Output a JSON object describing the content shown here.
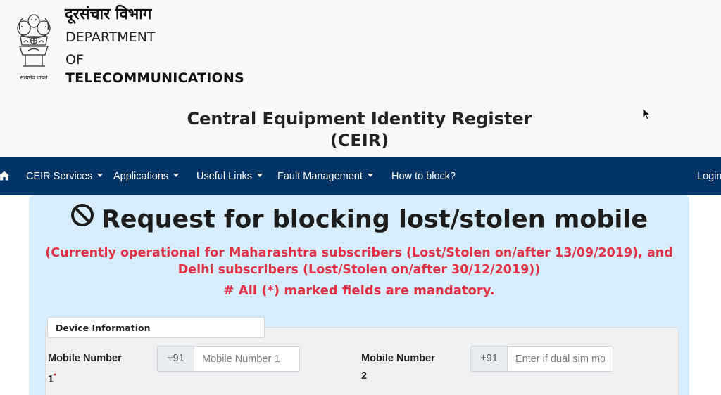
{
  "header": {
    "emblem_caption": "सत्यमेव जयते",
    "org_hindi": "दूरसंचार विभाग",
    "org_line1": "DEPARTMENT",
    "org_line2": "OF",
    "org_line3": "TELECOMMUNICATIONS",
    "site_title_line1": "Central Equipment Identity Register",
    "site_title_line2": "(CEIR)"
  },
  "nav": {
    "home_icon": "home-icon",
    "items": [
      {
        "label": "CEIR Services",
        "dropdown": true
      },
      {
        "label": "Applications",
        "dropdown": true
      },
      {
        "label": "Useful Links",
        "dropdown": true
      },
      {
        "label": "Fault Management",
        "dropdown": true
      },
      {
        "label": "How to block?",
        "dropdown": false
      }
    ],
    "login": "Login"
  },
  "request": {
    "icon": "ban-icon",
    "title": "Request for blocking lost/stolen mobile",
    "notice_line1": "(Currently operational for Maharashtra subscribers (Lost/Stolen on/after 13/09/2019), and",
    "notice_line2": "Delhi subscribers (Lost/Stolen on/after 30/12/2019))",
    "mandatory": "# All (*) marked fields are mandatory."
  },
  "device_info": {
    "tab_label": "Device Information",
    "field1": {
      "label_line1": "Mobile Number",
      "label_line2": "1",
      "required_mark": "*",
      "prefix": "+91",
      "value": "",
      "placeholder": "Mobile Number 1"
    },
    "field2": {
      "label_line1": "Mobile Number",
      "label_line2": "2",
      "prefix": "+91",
      "value": "",
      "placeholder": "Enter if dual sim mobile"
    }
  },
  "colors": {
    "navbar": "#003366",
    "panel": "#d7ecfc",
    "notice": "#e03345",
    "header_bg": "#f8f9fa"
  }
}
